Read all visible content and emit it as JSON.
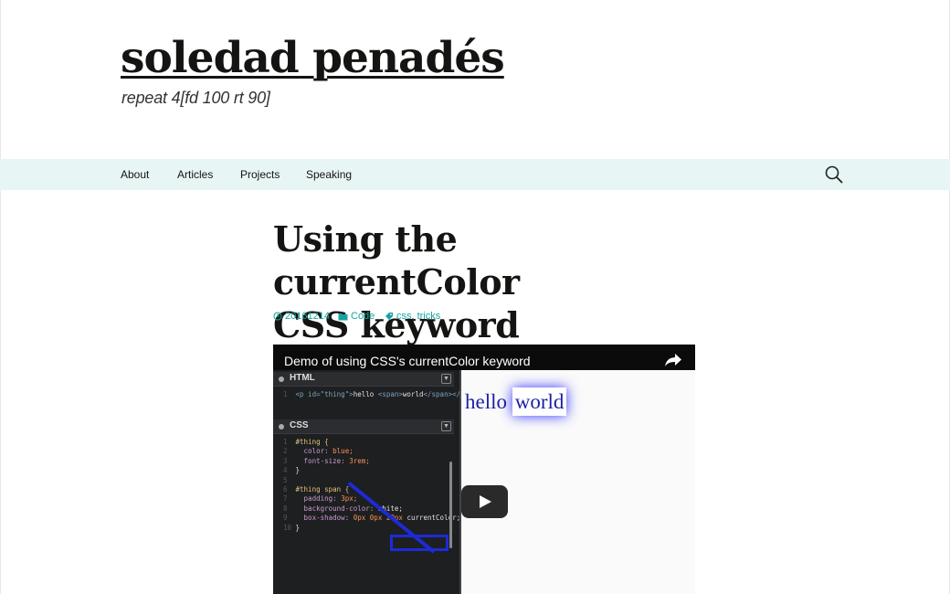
{
  "site": {
    "title": "soledad penadés",
    "description": "repeat 4[fd 100 rt 90]"
  },
  "nav": {
    "items": [
      {
        "label": "About"
      },
      {
        "label": "Articles"
      },
      {
        "label": "Projects"
      },
      {
        "label": "Speaking"
      }
    ],
    "search_icon": "search-icon"
  },
  "post": {
    "title_line1": "Using the currentColor",
    "title_line2": "CSS keyword",
    "meta": {
      "date": "20161214",
      "category": "Code",
      "tag1": "css",
      "tag_sep": ",",
      "tag2": "tricks"
    }
  },
  "video": {
    "title": "Demo of using CSS's currentColor keyword",
    "share_icon": "share-icon",
    "html_panel_label": "HTML",
    "css_panel_label": "CSS",
    "html_code": {
      "open": "<p id=\"thing\">",
      "text1": "hello ",
      "span_open": "<span>",
      "text2": "world",
      "close": "</span></p>"
    },
    "css_code": {
      "l1": "#thing {",
      "l2_prop": "color:",
      "l2_val": "blue;",
      "l3_prop": "font-size:",
      "l3_val": "3rem;",
      "l4": "}",
      "l6": "#thing span {",
      "l7_prop": "padding:",
      "l7_val": "3px;",
      "l8_prop": "background-color:",
      "l8_val": "white;",
      "l9_prop": "box-shadow:",
      "l9_val": "0px 0px 20px",
      "l9_kw": "currentColor;",
      "l10": "}"
    },
    "preview": {
      "text1": "hello ",
      "text2": "world"
    },
    "play_icon": "play-icon"
  },
  "colors": {
    "nav_bg": "#e8f5f5",
    "link": "#17a2a2",
    "highlight": "#1d2bd6"
  }
}
